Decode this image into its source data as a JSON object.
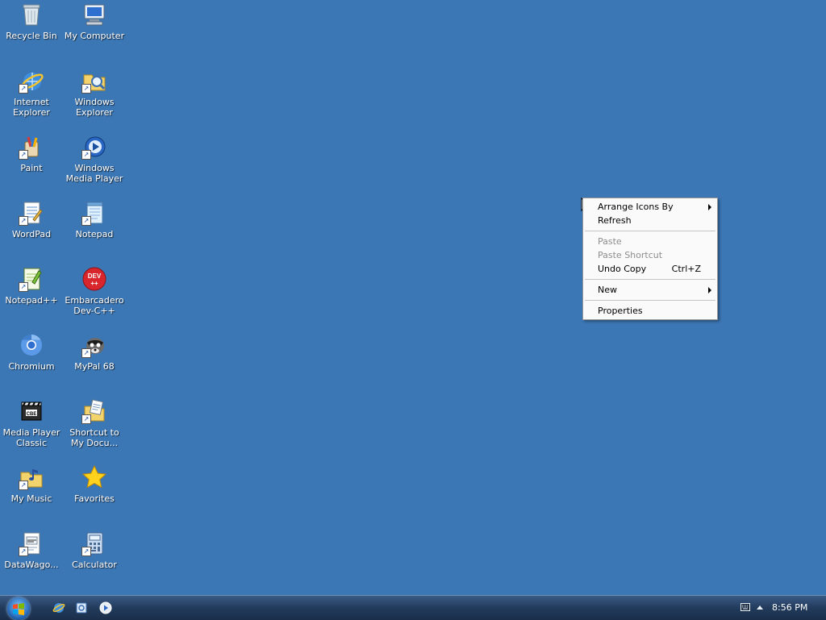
{
  "desktop": {
    "icons": [
      {
        "label": "Recycle Bin",
        "icon": "recycle-bin-icon"
      },
      {
        "label": "My Computer",
        "icon": "computer-icon"
      },
      {
        "label": "Internet\nExplorer",
        "icon": "internet-explorer-icon"
      },
      {
        "label": "Windows\nExplorer",
        "icon": "windows-explorer-icon"
      },
      {
        "label": "Paint",
        "icon": "paint-icon"
      },
      {
        "label": "Windows\nMedia Player",
        "icon": "media-player-icon"
      },
      {
        "label": "WordPad",
        "icon": "wordpad-icon"
      },
      {
        "label": "Notepad",
        "icon": "notepad-icon"
      },
      {
        "label": "Notepad++",
        "icon": "notepad-plus-icon"
      },
      {
        "label": "Embarcadero\nDev-C++",
        "icon": "devcpp-icon"
      },
      {
        "label": "Chromium",
        "icon": "chromium-icon"
      },
      {
        "label": "MyPal 68",
        "icon": "mypal-icon"
      },
      {
        "label": "Media Player\nClassic",
        "icon": "mpc-icon"
      },
      {
        "label": "Shortcut to\nMy Docu...",
        "icon": "documents-icon"
      },
      {
        "label": "My Music",
        "icon": "music-folder-icon"
      },
      {
        "label": "Favorites",
        "icon": "star-icon"
      },
      {
        "label": "DataWago...",
        "icon": "datawago-icon"
      },
      {
        "label": "Calculator",
        "icon": "calculator-icon"
      }
    ]
  },
  "context_menu": {
    "arrange": "Arrange Icons By",
    "refresh": "Refresh",
    "paste": "Paste",
    "paste_shortcut": "Paste Shortcut",
    "undo_copy": "Undo Copy",
    "undo_shortcut": "Ctrl+Z",
    "new": "New",
    "properties": "Properties"
  },
  "taskbar": {
    "quick_launch": [
      "internet-explorer-icon",
      "windows-explorer-icon",
      "media-player-icon"
    ],
    "clock": "8:56 PM"
  },
  "colors": {
    "desktop_bg": "#3c77b5",
    "menu_bg": "#fafafa",
    "menu_disabled_text": "#8d8d8d"
  }
}
